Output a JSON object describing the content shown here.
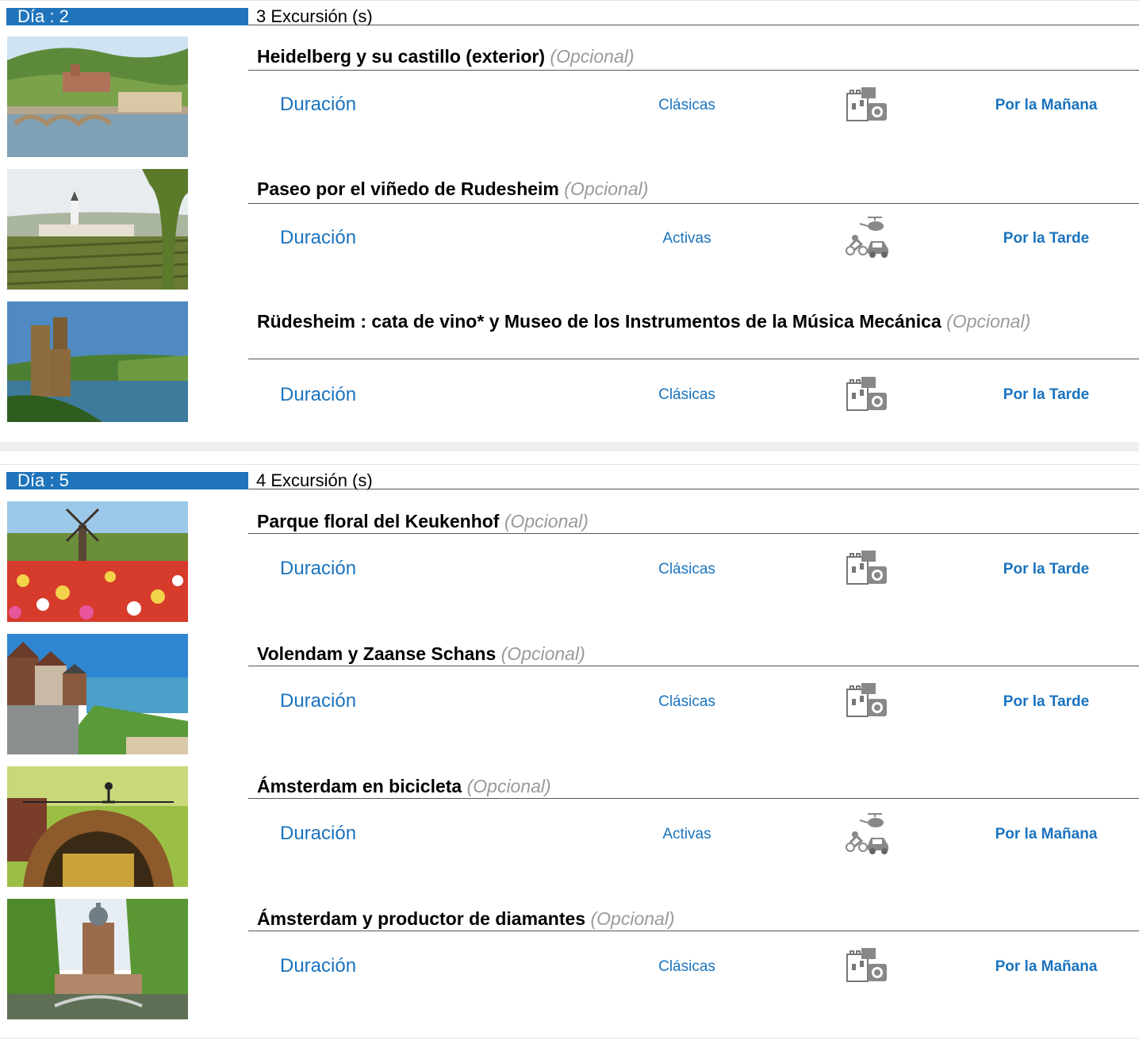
{
  "days": [
    {
      "label": "Día : 2",
      "count": "3 Excursión (s)",
      "items": [
        {
          "title": "Heidelberg y su castillo (exterior)",
          "optional": "(Opcional)",
          "duration": "Duración",
          "category": "Clásicas",
          "icon": "castle-camera-icon",
          "time": "Por la Mañana"
        },
        {
          "title": "Paseo por el viñedo de Rudesheim",
          "optional": "(Opcional)",
          "duration": "Duración",
          "category": "Activas",
          "icon": "active-transport-icon",
          "time": "Por la Tarde"
        },
        {
          "title": "Rüdesheim : cata de vino* y Museo de los Instrumentos de la Música Mecánica",
          "optional": "(Opcional)",
          "duration": "Duración",
          "category": "Clásicas",
          "icon": "castle-camera-icon",
          "time": "Por la Tarde"
        }
      ]
    },
    {
      "label": "Día : 5",
      "count": "4 Excursión (s)",
      "items": [
        {
          "title": "Parque floral del Keukenhof",
          "optional": "(Opcional)",
          "duration": "Duración",
          "category": "Clásicas",
          "icon": "castle-camera-icon",
          "time": "Por la Tarde"
        },
        {
          "title": "Volendam y Zaanse Schans",
          "optional": "(Opcional)",
          "duration": "Duración",
          "category": "Clásicas",
          "icon": "castle-camera-icon",
          "time": "Por la Tarde"
        },
        {
          "title": "Ámsterdam en bicicleta",
          "optional": "(Opcional)",
          "duration": "Duración",
          "category": "Activas",
          "icon": "active-transport-icon",
          "time": "Por la Mañana"
        },
        {
          "title": "Ámsterdam y productor de diamantes",
          "optional": "(Opcional)",
          "duration": "Duración",
          "category": "Clásicas",
          "icon": "castle-camera-icon",
          "time": "Por la Mañana"
        }
      ]
    }
  ]
}
